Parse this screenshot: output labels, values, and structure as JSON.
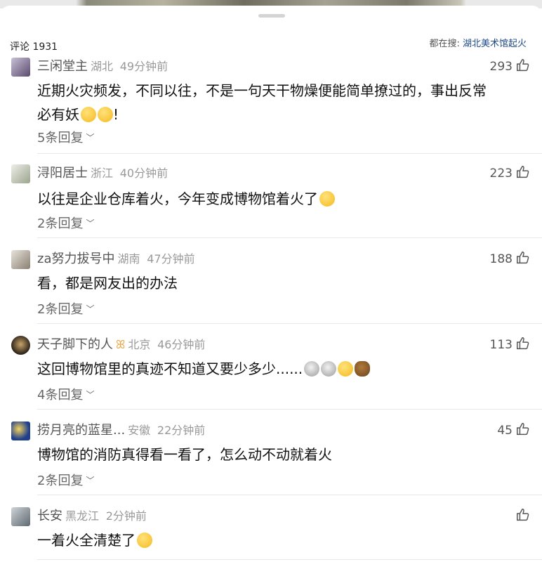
{
  "header": {
    "comment_count": "评论 1931",
    "search_prefix": "都在搜: ",
    "search_term": "湖北美术馆起火"
  },
  "comments": [
    {
      "user": "三闲堂主",
      "location": "湖北",
      "time": "49分钟前",
      "likes": "293",
      "text_lines": [
        "近期火灾频发，不同以往，不是一句天干物燥便能简单撩过的，事出反常",
        "必有妖"
      ],
      "emoji_after": "!",
      "replies": "5条回复"
    },
    {
      "user": "浔阳居士",
      "location": "浙江",
      "time": "40分钟前",
      "likes": "223",
      "text_lines": [
        "以往是企业仓库着火，今年变成博物馆着火了"
      ],
      "replies": "2条回复"
    },
    {
      "user": "za努力拔号中",
      "location": "湖南",
      "time": "47分钟前",
      "likes": "188",
      "text_lines": [
        "看，都是网友出的办法"
      ],
      "replies": "2条回复"
    },
    {
      "user": "天子脚下的人",
      "location": "北京",
      "time": "46分钟前",
      "likes": "113",
      "text_lines": [
        "这回博物馆里的真迹不知道又要少多少......"
      ],
      "replies": "4条回复"
    },
    {
      "user": "捞月亮的蓝星...",
      "location": "安徽",
      "time": "22分钟前",
      "likes": "45",
      "text_lines": [
        "博物馆的消防真得看一看了，怎么动不动就着火"
      ],
      "replies": "2条回复"
    },
    {
      "user": "长安",
      "location": "黑龙江",
      "time": "2分钟前",
      "likes": "",
      "text_lines": [
        "一着火全清楚了"
      ],
      "replies": ""
    }
  ],
  "icons": {
    "like": "thumbs-up-icon",
    "expand": "chevron-down-icon",
    "badge": "vip-ribbon-icon"
  },
  "colors": {
    "search_term": "#1f4a8a",
    "meta_gray": "#999999",
    "badge": "#e8a13a"
  }
}
